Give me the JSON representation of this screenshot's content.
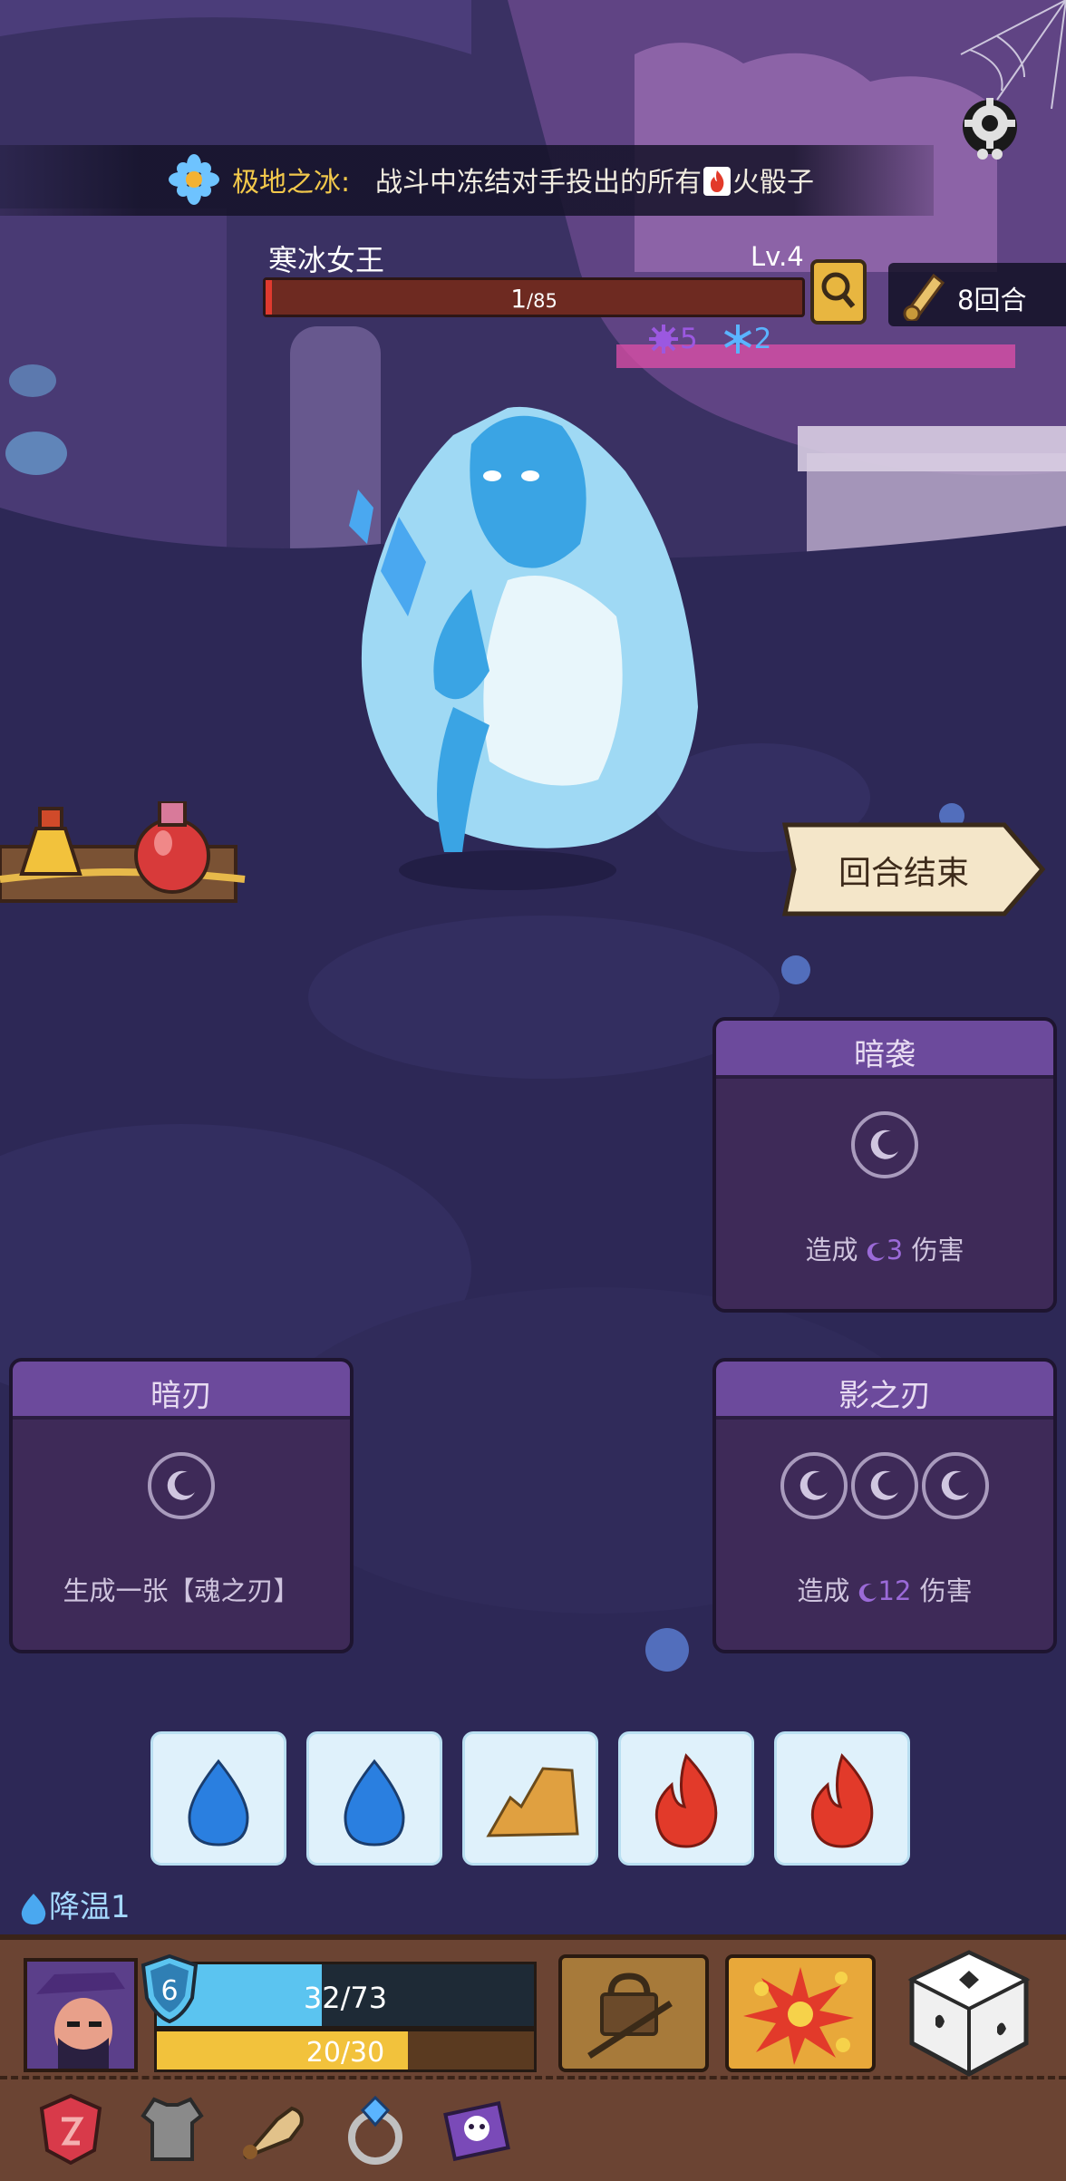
{
  "relic": {
    "name": "极地之冰:",
    "description_before": "战斗中冻结对手投出的所有",
    "description_after": "火骰子"
  },
  "enemy": {
    "name": "寒冰女王",
    "level": "Lv.4",
    "hp_current": "1",
    "hp_max": "/85",
    "hp_fraction": 0.012,
    "status_effects": [
      {
        "icon": "spiky-curse-icon",
        "value": "5",
        "color": "#9b58e0"
      },
      {
        "icon": "snowflake-icon",
        "value": "2",
        "color": "#5ab4ff"
      }
    ]
  },
  "turn_counter": "8回合",
  "end_turn_label": "回合结束",
  "cards": [
    {
      "title": "暗袭",
      "slots": 1,
      "desc_before": "造成",
      "desc_value": "3",
      "desc_after": "伤害"
    },
    {
      "title": "暗刃",
      "slots": 1,
      "desc_text": "生成一张【魂之刃】"
    },
    {
      "title": "影之刃",
      "slots": 3,
      "desc_before": "造成",
      "desc_value": "12",
      "desc_after": "伤害"
    }
  ],
  "dice": [
    {
      "type": "water-drop-icon",
      "color": "#2a7fe0",
      "frozen": true
    },
    {
      "type": "water-drop-icon",
      "color": "#2a7fe0",
      "frozen": true
    },
    {
      "type": "earth-rock-icon",
      "color": "#e0a040",
      "frozen": true
    },
    {
      "type": "fire-icon",
      "color": "#e23a2a",
      "frozen": true
    },
    {
      "type": "fire-icon",
      "color": "#e23a2a",
      "frozen": true
    }
  ],
  "player_status": "降温1",
  "player": {
    "shield": "6",
    "hp": "32/73",
    "hp_fraction": 0.438,
    "energy": "20/30",
    "energy_fraction": 0.667
  },
  "colors": {
    "background": "#2b2750",
    "card": "#3e2a58",
    "card_header": "#6c4a9c",
    "hp_red": "#e03a2f",
    "player_hp": "#5bc4f0",
    "energy": "#f2c23c",
    "relic_name": "#f2c84b"
  }
}
